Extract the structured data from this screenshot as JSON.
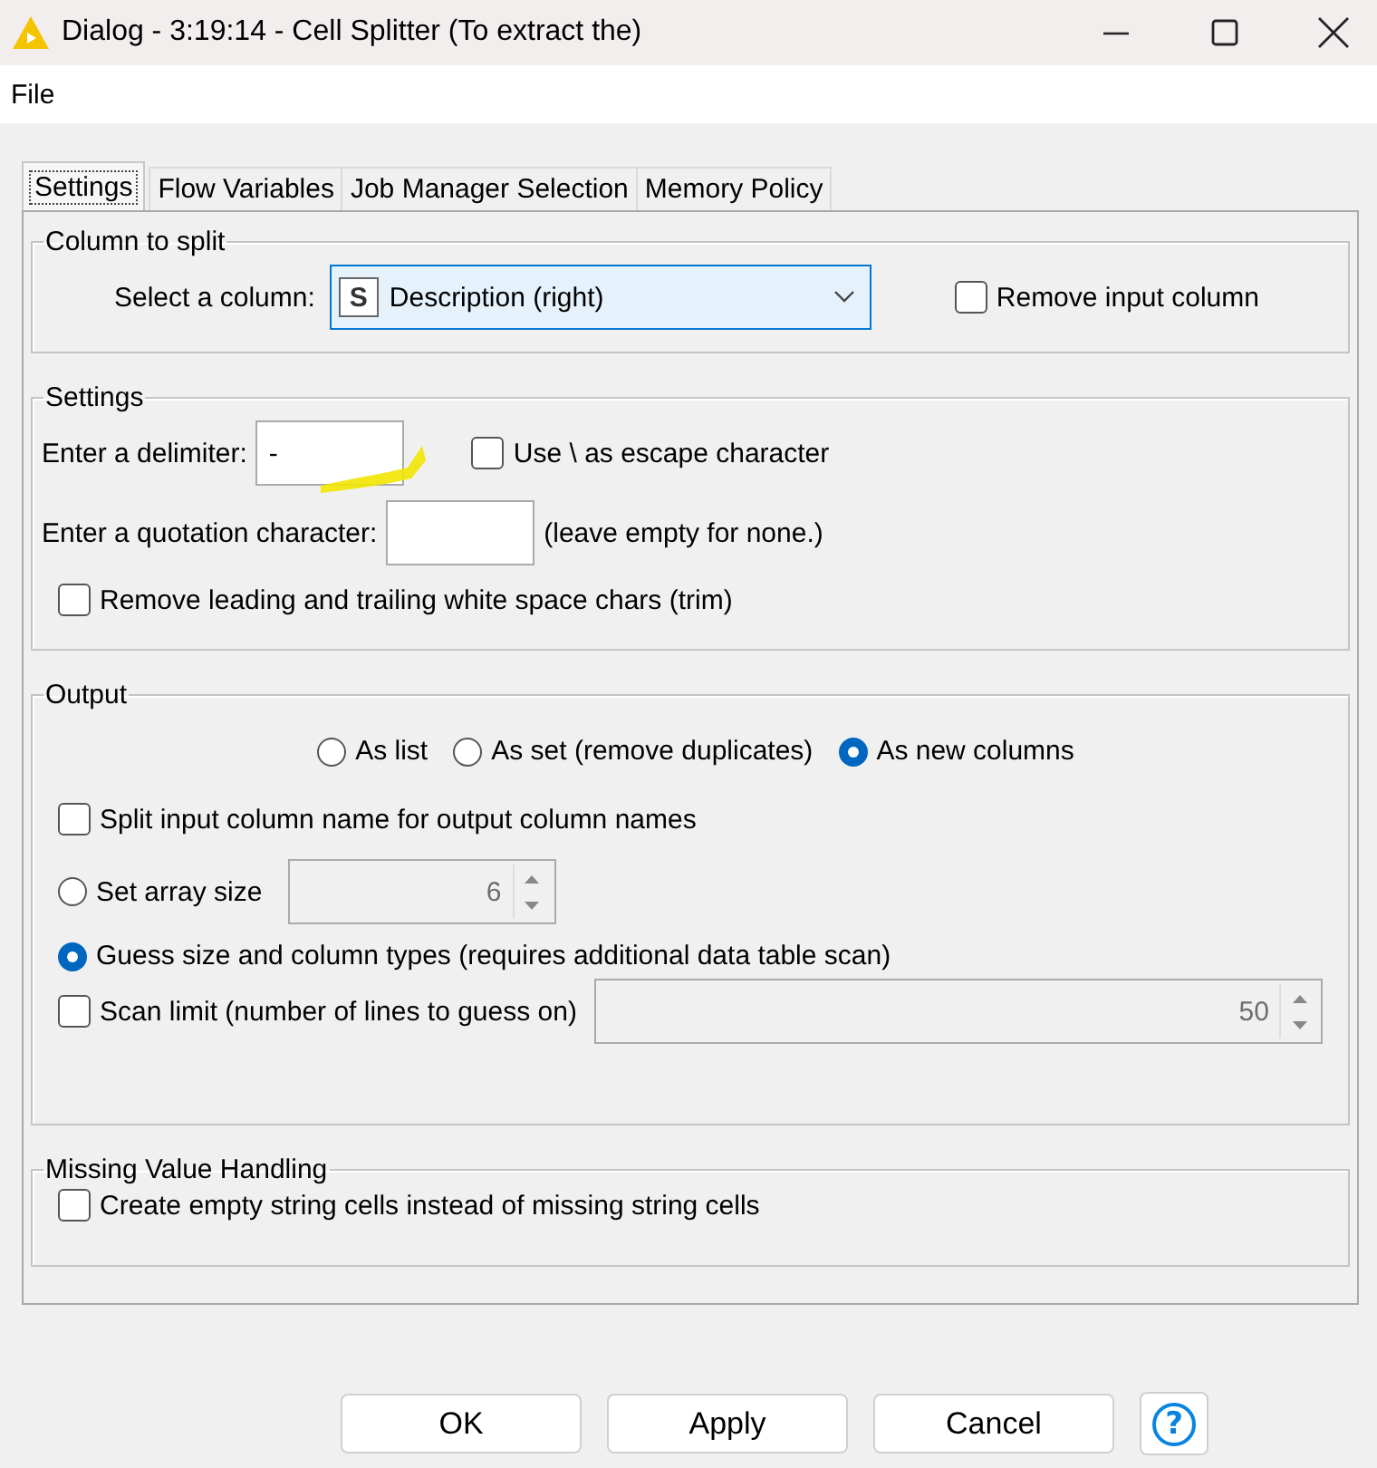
{
  "window": {
    "title": "Dialog - 3:19:14 - Cell Splitter (To extract the)"
  },
  "menu": [
    "File"
  ],
  "tabs": [
    {
      "label": "Settings",
      "selected": true
    },
    {
      "label": "Flow Variables",
      "selected": false
    },
    {
      "label": "Job Manager Selection",
      "selected": false
    },
    {
      "label": "Memory Policy",
      "selected": false
    }
  ],
  "column_to_split": {
    "title": "Column to split",
    "label": "Select a column:",
    "type_badge": "S",
    "value": "Description (right)",
    "remove_input_column": {
      "label": "Remove input column",
      "checked": false
    }
  },
  "settings": {
    "title": "Settings",
    "delimiter": {
      "label": "Enter a delimiter:",
      "value": "-"
    },
    "escape": {
      "label": "Use \\ as escape character",
      "checked": false
    },
    "quotation": {
      "label": "Enter a quotation character:",
      "note": "(leave empty for none.)"
    },
    "trim": {
      "label": "Remove leading and trailing white space chars (trim)",
      "checked": false
    }
  },
  "output": {
    "title": "Output",
    "modes": [
      {
        "label": "As list",
        "selected": false
      },
      {
        "label": "As set (remove duplicates)",
        "selected": false
      },
      {
        "label": "As new columns",
        "selected": true
      }
    ],
    "split_names": {
      "label": "Split input column name for output column names",
      "checked": false
    },
    "array_size": {
      "label": "Set array size",
      "selected": false,
      "value": "6"
    },
    "guess": {
      "label": "Guess size and column types (requires additional data table scan)",
      "selected": true
    },
    "scan_limit": {
      "label": "Scan limit (number of lines to guess on)",
      "checked": false,
      "value": "50"
    }
  },
  "missing": {
    "title": "Missing Value Handling",
    "empty_cells": {
      "label": "Create empty string cells instead of missing string cells",
      "checked": false
    }
  },
  "buttons": [
    {
      "kind": "text",
      "label": "OK"
    },
    {
      "kind": "text",
      "label": "Apply"
    },
    {
      "kind": "text",
      "label": "Cancel"
    },
    {
      "kind": "help",
      "label": "?"
    }
  ]
}
